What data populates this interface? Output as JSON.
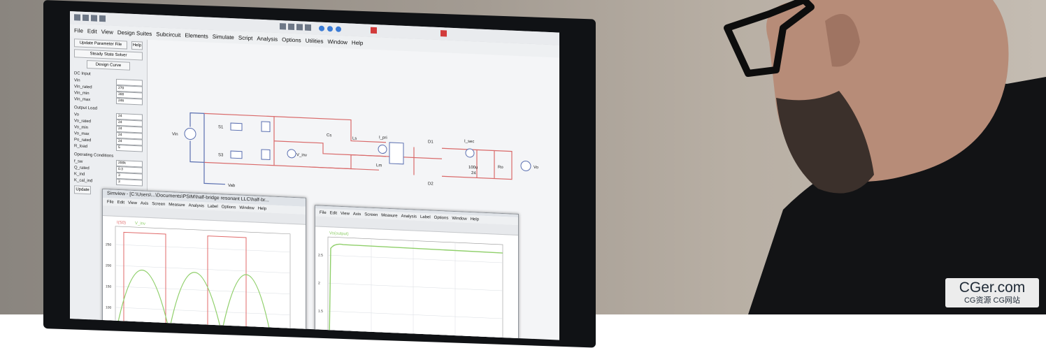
{
  "main_menu": [
    "File",
    "Edit",
    "View",
    "Design Suites",
    "Subcircuit",
    "Elements",
    "Simulate",
    "Script",
    "Analysis",
    "Options",
    "Utilities",
    "Window",
    "Help"
  ],
  "left_panel": {
    "buttons": [
      "Update Parameter File",
      "Help",
      "Steady State Solver",
      "Design Curve"
    ],
    "dc_input": {
      "title": "DC Input",
      "rows": [
        [
          "Vin",
          ""
        ],
        [
          "Vin_rated",
          "270"
        ],
        [
          "Vin_min",
          "300"
        ],
        [
          "Vin_max",
          "246"
        ]
      ]
    },
    "output_load": {
      "title": "Output Load",
      "rows": [
        [
          "Vo",
          "24"
        ],
        [
          "Vo_rated",
          "24"
        ],
        [
          "Vo_min",
          "24"
        ],
        [
          "Vo_max",
          "24"
        ],
        [
          "Po_rated",
          "24"
        ],
        [
          "R_load",
          "5"
        ]
      ]
    },
    "operating": {
      "title": "Operating Conditions",
      "rows": [
        [
          "f_sw",
          "200k"
        ],
        [
          "Q_rated",
          "0.3"
        ],
        [
          "K_ind",
          "3"
        ],
        [
          "K_cal_ind",
          "3"
        ]
      ]
    },
    "update_button": "Update"
  },
  "schematic_labels": {
    "vin": "Vin",
    "s1": "S1",
    "s3": "S3",
    "cs": "Cs",
    "ls": "Ls",
    "i_pri": "I_pri",
    "lm": "Lm",
    "v_inv": "V_inv",
    "d1": "D1",
    "d2": "D2",
    "i_sec": "I_sec",
    "cap": "100u",
    "cap2": "24",
    "ro": "Ro",
    "vo": "Vo",
    "vab": "Vab"
  },
  "scope_left": {
    "title": "Simview - [C:\\Users\\...\\Documents\\PSIM\\half-bridge resonant LLC\\half-br...",
    "menus": [
      "File",
      "Edit",
      "View",
      "Axis",
      "Screen",
      "Measure",
      "Analysis",
      "Label",
      "Options",
      "Window",
      "Help"
    ],
    "legend": [
      "I(S0)",
      "V_inv"
    ],
    "yticks": [
      "250",
      "200",
      "150",
      "100",
      "50"
    ]
  },
  "scope_right": {
    "menus": [
      "File",
      "Edit",
      "View",
      "Axis",
      "Screen",
      "Measure",
      "Analysis",
      "Label",
      "Options",
      "Window",
      "Help"
    ],
    "legend": [
      "Vo(output)"
    ],
    "yticks": [
      "2.5",
      "2",
      "1.5"
    ]
  },
  "watermark": {
    "line1": "CGer.com",
    "line2": "CG资源 CG网站"
  },
  "colors": {
    "wire_red": "#d96a6a",
    "wire_blue": "#5a6fb0",
    "trace_green": "#8fcf6a",
    "trace_red": "#e06a6a"
  }
}
